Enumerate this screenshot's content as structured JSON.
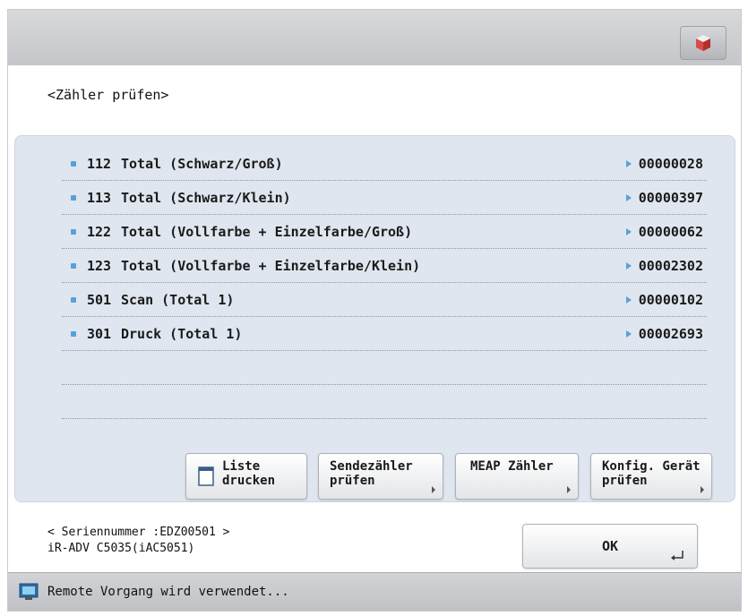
{
  "screen": {
    "title": "<Zähler prüfen>"
  },
  "counters": [
    {
      "code": "112",
      "label": "Total (Schwarz/Groß)",
      "value": "00000028"
    },
    {
      "code": "113",
      "label": "Total (Schwarz/Klein)",
      "value": "00000397"
    },
    {
      "code": "122",
      "label": "Total (Vollfarbe + Einzelfarbe/Groß)",
      "value": "00000062"
    },
    {
      "code": "123",
      "label": "Total (Vollfarbe + Einzelfarbe/Klein)",
      "value": "00002302"
    },
    {
      "code": "501",
      "label": "Scan (Total 1)",
      "value": "00000102"
    },
    {
      "code": "301",
      "label": "Druck (Total 1)",
      "value": "00002693"
    }
  ],
  "buttons": {
    "print_list": "Liste\ndrucken",
    "check_send_counter": "Sendezähler\nprüfen",
    "meap_counter": "MEAP Zähler",
    "check_device_config": "Konfig. Gerät\nprüfen",
    "ok": "OK"
  },
  "device": {
    "serial_line": "< Seriennummer :EDZ00501 >",
    "model_line": "iR-ADV C5035(iAC5051)"
  },
  "status": {
    "text": "Remote Vorgang wird verwendet..."
  },
  "icons": {
    "top_right": "cube-icon",
    "print_list": "printer-icon",
    "ok_enter": "enter-icon",
    "status": "monitor-icon"
  },
  "colors": {
    "accent": "#5aa0d8",
    "panel": "#dfe6ef"
  }
}
